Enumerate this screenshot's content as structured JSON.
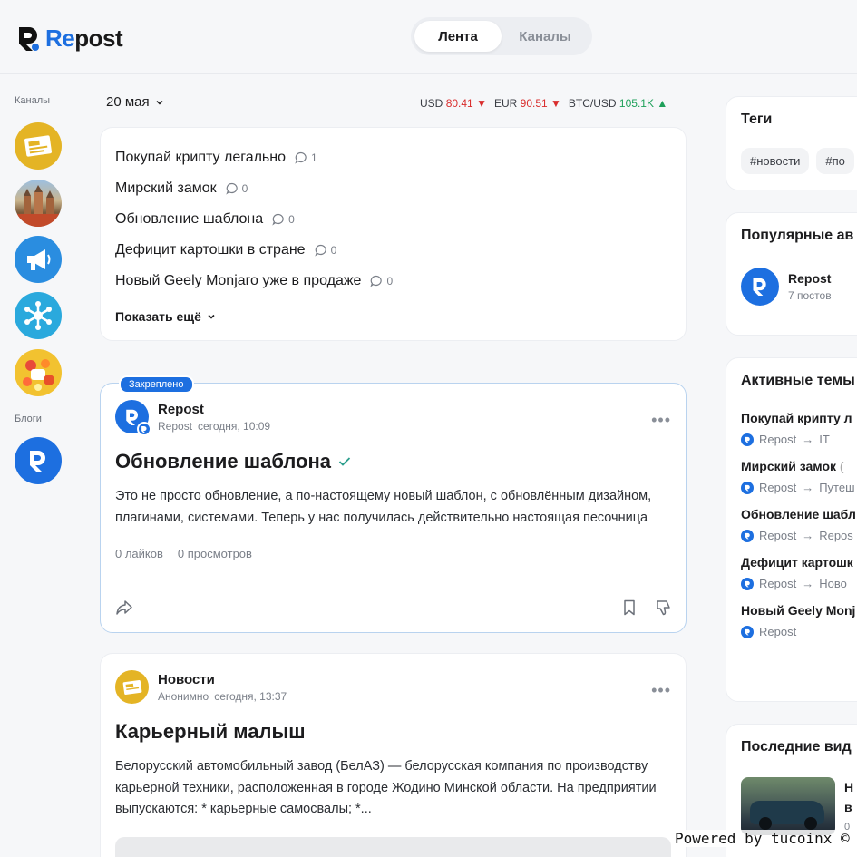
{
  "header": {
    "logo_prefix": "Re",
    "logo_suffix": "post",
    "tabs": [
      {
        "label": "Лента",
        "active": true
      },
      {
        "label": "Каналы",
        "active": false
      }
    ]
  },
  "sidebar": {
    "channels_label": "Каналы",
    "channels": [
      {
        "icon": "news-icon",
        "color": "#e4b425"
      },
      {
        "icon": "castle-photo",
        "color": "#8a6c4f"
      },
      {
        "icon": "megaphone-icon",
        "color": "#2a8de0"
      },
      {
        "icon": "network-icon",
        "color": "#2aa9dd"
      },
      {
        "icon": "games-icon",
        "color": "#f2c230"
      }
    ],
    "blogs_label": "Блоги",
    "blogs": [
      {
        "icon": "repost-logo-icon",
        "color": "#1d6fe0"
      }
    ]
  },
  "feed": {
    "date": "20 мая",
    "rates": {
      "usd_label": "USD",
      "usd_value": "80.41",
      "eur_label": "EUR",
      "eur_value": "90.51",
      "btc_label": "BTC/USD",
      "btc_value": "105.1K"
    },
    "topics": [
      {
        "title": "Покупай крипту легально",
        "comments": "1"
      },
      {
        "title": "Мирский замок",
        "comments": "0"
      },
      {
        "title": "Обновление шаблона",
        "comments": "0"
      },
      {
        "title": "Дефицит картошки в стране",
        "comments": "0"
      },
      {
        "title": "Новый Geely Monjaro уже в продаже",
        "comments": "0"
      }
    ],
    "show_more": "Показать ещё",
    "posts": [
      {
        "pinned_label": "Закреплено",
        "author": "Repost",
        "sub": "Repost",
        "time": "сегодня, 10:09",
        "title": "Обновление шаблона",
        "text": "Это не просто обновление, а по-настоящему новый шаблон, с обновлённым дизайном, плагинами, системами. Теперь у нас получилась действительно настоящая песочница",
        "likes": "0 лайков",
        "views": "0 просмотров"
      },
      {
        "author": "Новости",
        "sub": "Анонимно",
        "time": "сегодня, 13:37",
        "title": "Карьерный малыш",
        "text": "Белорусский автомобильный завод (БелАЗ) — белорусская компания по производству карьерной техники, расположенная в городе Жодино Минской области. На предприятии выпускаются: * карьерные самосвалы; *..."
      }
    ]
  },
  "right": {
    "tags_title": "Теги",
    "tags": [
      "#новости",
      "#по"
    ],
    "popular_title": "Популярные ав",
    "popular_author": "Repost",
    "popular_posts": "7 постов",
    "active_title": "Активные темы",
    "active": [
      {
        "title": "Покупай крипту л",
        "author": "Repost",
        "arrow": "→",
        "target": "IT"
      },
      {
        "title": "Мирский замок",
        "extra": "(",
        "author": "Repost",
        "arrow": "→",
        "target": "Путеш"
      },
      {
        "title": "Обновление шабл",
        "author": "Repost",
        "arrow": "→",
        "target": "Repos"
      },
      {
        "title": "Дефицит картошк",
        "author": "Repost",
        "arrow": "→",
        "target": "Ново"
      },
      {
        "title": "Новый Geely Monj",
        "author": "Repost",
        "arrow": "",
        "target": ""
      }
    ],
    "videos_title": "Последние вид",
    "video_peek_1": "Н",
    "video_peek_2": "в",
    "video_peek_3": "0"
  },
  "powered": "Powered by tucoinx ©",
  "colors": {
    "accent": "#1d6fe0",
    "down": "#d92d2d",
    "up": "#1fa05a"
  }
}
